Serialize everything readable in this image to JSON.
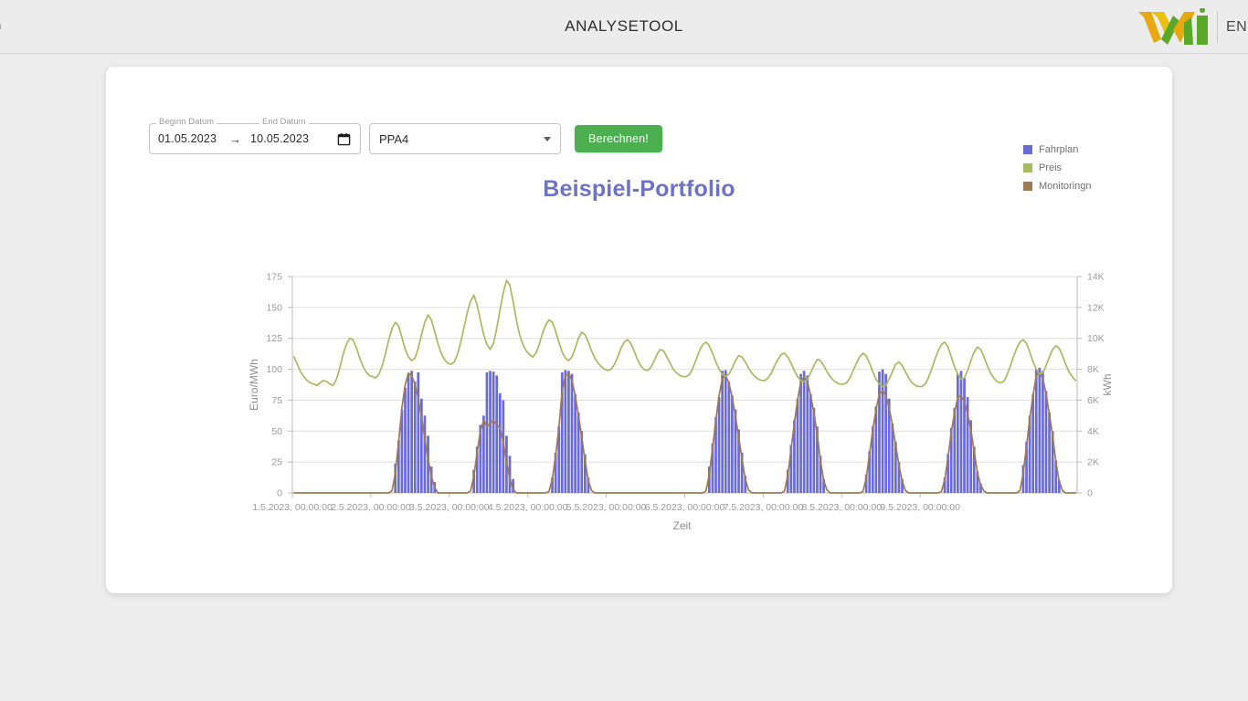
{
  "topbar": {
    "left_text": "n",
    "title": "ANALYSETOOL",
    "logo_name": "wvi-logo",
    "logo_text": "EN"
  },
  "controls": {
    "begin_label": "Beginn Datum",
    "end_label": "End Datum",
    "begin_value": "01.05.2023",
    "end_value": "10.05.2023",
    "range_separator": "→",
    "calendar_icon": "calendar-icon",
    "select_value": "PPA4",
    "select_options": [
      "PPA4"
    ],
    "caret_icon": "chevron-down-icon",
    "calculate_label": "Berechnen!"
  },
  "colors": {
    "fahrplan": "#6b6bd6",
    "preis": "#a9b95f",
    "monitoring": "#a07a50",
    "title": "#6c73c4",
    "accent_button": "#4caf50",
    "grid": "#dedede",
    "axis_text": "#9a9a9a"
  },
  "chart_data": {
    "type": "bar",
    "title": "Beispiel-Portfolio",
    "xlabel": "Zeit",
    "ylabel": "Euro/MWh",
    "y2label": "kWh",
    "grid": true,
    "legend_position": "right",
    "ylim": [
      0,
      175
    ],
    "yticks": [
      0,
      25,
      50,
      75,
      100,
      125,
      150,
      175
    ],
    "ytick_labels": [
      "0",
      "25",
      "50",
      "75",
      "100",
      "125",
      "150",
      "175"
    ],
    "y2lim": [
      0,
      14000
    ],
    "y2ticks": [
      0,
      2000,
      4000,
      6000,
      8000,
      10000,
      12000,
      14000
    ],
    "y2tick_labels": [
      "0",
      "2K",
      "4K",
      "6K",
      "8K",
      "10K",
      "12K",
      "14K"
    ],
    "xtick_labels": [
      "1.5.2023, 00:00:00",
      "2.5.2023, 00:00:00",
      "3.5.2023, 00:00:00",
      "4.5.2023, 00:00:00",
      "5.5.2023, 00:00:00",
      "6.5.2023, 00:00:00",
      "7.5.2023, 00:00:00",
      "8.5.2023, 00:00:00",
      "9.5.2023, 00:00:00"
    ],
    "x_hours_total": 240,
    "series": [
      {
        "name": "Fahrplan",
        "type": "bar",
        "axis": "right",
        "unit": "kWh",
        "values": [
          0,
          0,
          0,
          0,
          0,
          0,
          0,
          0,
          0,
          0,
          0,
          0,
          0,
          0,
          0,
          0,
          0,
          0,
          0,
          0,
          0,
          0,
          0,
          0,
          0,
          0,
          0,
          0,
          0,
          0,
          0,
          1900,
          3400,
          5400,
          6800,
          7750,
          7900,
          7200,
          7800,
          6100,
          5000,
          3700,
          1700,
          700,
          0,
          0,
          0,
          0,
          0,
          0,
          0,
          0,
          0,
          0,
          0,
          1500,
          3000,
          4400,
          5000,
          7800,
          7900,
          7850,
          7600,
          6450,
          6000,
          3700,
          2400,
          900,
          0,
          0,
          0,
          0,
          0,
          0,
          0,
          0,
          0,
          0,
          0,
          1000,
          2600,
          4300,
          7800,
          7950,
          7900,
          7700,
          6400,
          5200,
          4000,
          2500,
          1000,
          0,
          0,
          0,
          0,
          0,
          0,
          0,
          0,
          0,
          0,
          0,
          0,
          0,
          0,
          0,
          0,
          0,
          0,
          0,
          0,
          0,
          0,
          0,
          0,
          0,
          0,
          0,
          0,
          0,
          0,
          0,
          0,
          0,
          0,
          0,
          0,
          1700,
          3200,
          4900,
          6200,
          7900,
          7950,
          7200,
          6300,
          5400,
          4100,
          2600,
          1100,
          0,
          0,
          0,
          0,
          0,
          0,
          0,
          0,
          0,
          0,
          0,
          0,
          1500,
          3100,
          4700,
          6100,
          7700,
          7900,
          7600,
          6400,
          5500,
          4300,
          2400,
          900,
          0,
          0,
          0,
          0,
          0,
          0,
          0,
          0,
          0,
          0,
          0,
          0,
          1200,
          2700,
          4300,
          5600,
          7850,
          8000,
          7700,
          6100,
          4500,
          3300,
          2000,
          900,
          0,
          0,
          0,
          0,
          0,
          0,
          0,
          0,
          0,
          0,
          0,
          0,
          1000,
          2500,
          4200,
          5500,
          7700,
          7900,
          7450,
          6200,
          4700,
          3000,
          1400,
          600,
          0,
          0,
          0,
          0,
          0,
          0,
          0,
          0,
          0,
          0,
          0,
          0,
          1800,
          3300,
          5000,
          6400,
          8000,
          8100,
          7900,
          6600,
          5200,
          4000,
          2100,
          800,
          0,
          0,
          0,
          0,
          0
        ]
      },
      {
        "name": "Preis",
        "type": "line",
        "axis": "left",
        "unit": "Euro/MWh",
        "values": [
          110,
          104,
          98,
          94,
          91,
          89,
          88,
          87,
          89,
          91,
          90,
          88,
          87,
          92,
          101,
          112,
          120,
          125,
          124,
          118,
          110,
          103,
          98,
          95,
          94,
          93,
          96,
          103,
          113,
          124,
          133,
          138,
          135,
          126,
          116,
          110,
          107,
          109,
          117,
          128,
          138,
          144,
          140,
          131,
          121,
          113,
          108,
          105,
          104,
          106,
          112,
          122,
          134,
          146,
          155,
          160,
          152,
          140,
          128,
          120,
          116,
          121,
          133,
          148,
          162,
          172,
          168,
          155,
          140,
          128,
          120,
          115,
          112,
          110,
          113,
          120,
          129,
          136,
          140,
          138,
          131,
          122,
          114,
          109,
          107,
          110,
          117,
          125,
          130,
          128,
          122,
          115,
          109,
          105,
          102,
          100,
          99,
          100,
          104,
          110,
          117,
          122,
          124,
          121,
          115,
          108,
          103,
          100,
          99,
          101,
          106,
          112,
          116,
          115,
          110,
          105,
          100,
          97,
          95,
          94,
          94,
          96,
          101,
          108,
          115,
          120,
          122,
          119,
          113,
          106,
          100,
          96,
          94,
          96,
          101,
          107,
          111,
          110,
          106,
          101,
          97,
          94,
          92,
          91,
          91,
          93,
          97,
          103,
          108,
          112,
          113,
          110,
          105,
          99,
          94,
          91,
          90,
          92,
          97,
          103,
          108,
          107,
          103,
          98,
          94,
          91,
          89,
          88,
          88,
          89,
          93,
          99,
          105,
          110,
          113,
          111,
          105,
          98,
          92,
          88,
          86,
          87,
          92,
          98,
          104,
          106,
          103,
          98,
          93,
          89,
          87,
          86,
          86,
          88,
          93,
          100,
          108,
          115,
          120,
          122,
          118,
          110,
          102,
          96,
          92,
          93,
          99,
          107,
          114,
          118,
          116,
          110,
          103,
          97,
          93,
          90,
          89,
          90,
          95,
          102,
          110,
          117,
          122,
          124,
          121,
          114,
          106,
          100,
          96,
          97,
          103,
          110,
          116,
          119,
          117,
          111,
          104,
          98,
          94,
          91
        ]
      },
      {
        "name": "Monitoringn",
        "type": "line",
        "axis": "right",
        "unit": "kWh",
        "values": [
          0,
          0,
          0,
          0,
          0,
          0,
          0,
          0,
          0,
          0,
          0,
          0,
          0,
          0,
          0,
          0,
          0,
          0,
          0,
          0,
          0,
          0,
          0,
          0,
          0,
          0,
          0,
          0,
          0,
          0,
          150,
          1300,
          3300,
          5500,
          7000,
          7750,
          7600,
          7000,
          6100,
          4900,
          3500,
          2200,
          1100,
          350,
          0,
          0,
          0,
          0,
          0,
          0,
          0,
          0,
          0,
          0,
          120,
          1100,
          2600,
          4000,
          4700,
          4300,
          4500,
          4700,
          4400,
          4200,
          3300,
          2000,
          900,
          250,
          0,
          0,
          0,
          0,
          0,
          0,
          0,
          0,
          0,
          0,
          100,
          900,
          2400,
          4200,
          6600,
          7600,
          7700,
          7300,
          6300,
          5000,
          3600,
          2100,
          800,
          150,
          0,
          0,
          0,
          0,
          0,
          0,
          0,
          0,
          0,
          0,
          0,
          0,
          0,
          0,
          0,
          0,
          0,
          0,
          0,
          0,
          0,
          0,
          0,
          0,
          0,
          0,
          0,
          0,
          0,
          0,
          0,
          0,
          0,
          0,
          130,
          1200,
          2900,
          4700,
          6300,
          7400,
          7600,
          7100,
          6200,
          5000,
          3600,
          2200,
          900,
          200,
          0,
          0,
          0,
          0,
          0,
          0,
          0,
          0,
          0,
          0,
          120,
          1100,
          2800,
          4500,
          6000,
          7200,
          7500,
          7200,
          6300,
          5200,
          3800,
          2100,
          800,
          180,
          0,
          0,
          0,
          0,
          0,
          0,
          0,
          0,
          0,
          0,
          100,
          950,
          2500,
          4100,
          5400,
          6400,
          6600,
          6300,
          5500,
          4400,
          3100,
          1800,
          750,
          150,
          0,
          0,
          0,
          0,
          0,
          0,
          0,
          0,
          0,
          0,
          90,
          850,
          2300,
          3900,
          5200,
          6200,
          6300,
          5900,
          5100,
          4100,
          2700,
          1300,
          500,
          120,
          0,
          0,
          0,
          0,
          0,
          0,
          0,
          0,
          0,
          0,
          140,
          1250,
          3000,
          4800,
          6300,
          7600,
          7800,
          7400,
          6400,
          5100,
          3700,
          2000,
          750,
          160,
          0,
          0,
          0,
          0
        ]
      }
    ]
  },
  "legend": {
    "items": [
      {
        "label": "Fahrplan",
        "color": "#6b6bd6"
      },
      {
        "label": "Preis",
        "color": "#a9b95f"
      },
      {
        "label": "Monitoringn",
        "color": "#a07a50"
      }
    ]
  }
}
